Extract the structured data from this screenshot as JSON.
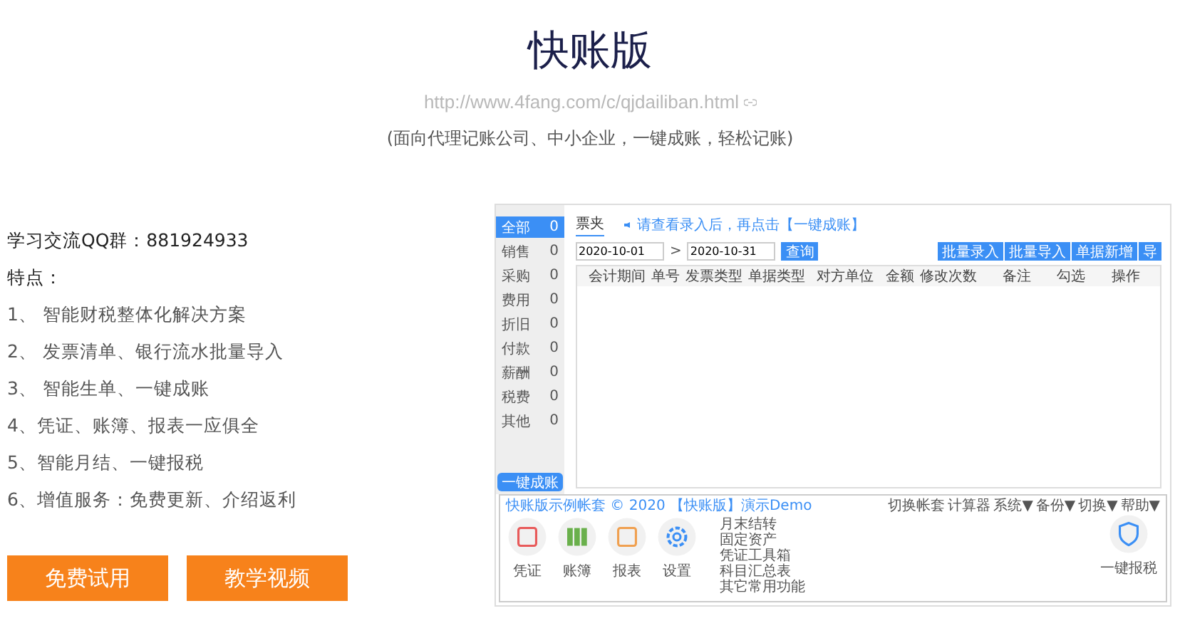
{
  "title": "快账版",
  "url": "http://www.4fang.com/c/qjdailiban.html",
  "subtitle": "(面向代理记账公司、中小企业，一键成账，轻松记账)",
  "qq": "学习交流QQ群：881924933",
  "features_title": "特点：",
  "features": [
    "1、 智能财税整体化解决方案",
    "2、 发票清单、银行流水批量导入",
    "3、 智能生单、一键成账",
    "4、凭证、账簿、报表一应俱全",
    "5、智能月结、一键报税",
    "6、增值服务：免费更新、介绍返利"
  ],
  "buttons": [
    "免费试用",
    "教学视频"
  ],
  "app": {
    "sidebar": [
      {
        "label": "全部",
        "count": "0",
        "selected": true
      },
      {
        "label": "销售",
        "count": "0",
        "selected": false
      },
      {
        "label": "采购",
        "count": "0",
        "selected": false
      },
      {
        "label": "费用",
        "count": "0",
        "selected": false
      },
      {
        "label": "折旧",
        "count": "0",
        "selected": false
      },
      {
        "label": "付款",
        "count": "0",
        "selected": false
      },
      {
        "label": "薪酬",
        "count": "0",
        "selected": false
      },
      {
        "label": "税费",
        "count": "0",
        "selected": false
      },
      {
        "label": "其他",
        "count": "0",
        "selected": false
      }
    ],
    "sidebar_button": "一键成账",
    "tab": "票夹",
    "hint": "请查看录入后，再点击【一键成账】",
    "date_from": "2020-10-01",
    "date_sep": ">",
    "date_to": "2020-10-31",
    "query_button": "查询",
    "actions": [
      "批量录入",
      "批量导入",
      "单据新增",
      "导"
    ],
    "columns": [
      "会计期间",
      "单号",
      "发票类型",
      "单据类型",
      "对方单位",
      "金额",
      "修改次数",
      "备注",
      "勾选",
      "操作"
    ],
    "status": "快账版示例帐套 © 2020 【快账版】演示Demo",
    "menu": [
      "切换帐套",
      "计算器",
      "系统▼",
      "备份▼",
      "切换▼",
      "帮助▼"
    ],
    "modules": [
      {
        "label": "凭证",
        "kind": "voucher"
      },
      {
        "label": "账簿",
        "kind": "ledger"
      },
      {
        "label": "报表",
        "kind": "report"
      },
      {
        "label": "设置",
        "kind": "settings"
      }
    ],
    "links": [
      "月末结转",
      "固定资产",
      "凭证工具箱",
      "科目汇总表",
      "其它常用功能"
    ],
    "tax_button": "一键报税"
  }
}
